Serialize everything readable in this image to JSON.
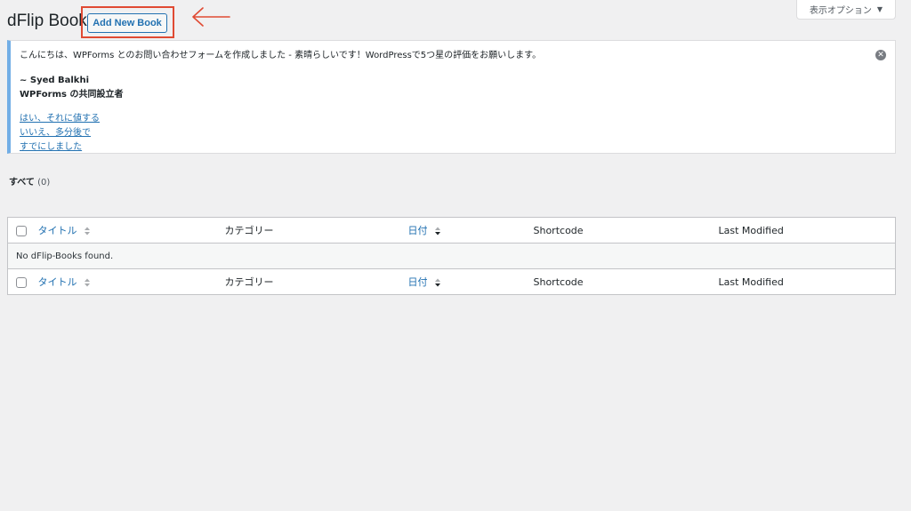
{
  "header": {
    "title": "dFlip Book",
    "add_new_label": "Add New Book",
    "screen_options_label": "表示オプション"
  },
  "notice": {
    "message": "こんにちは、WPForms とのお問い合わせフォームを作成しました - 素晴らしいです！WordPressで5つ星の評価をお願いします。",
    "signature_name": "~ Syed Balkhi",
    "signature_role": "WPForms の共同設立者",
    "links": [
      "はい、それに値する",
      "いいえ、多分後で",
      "すでにしました"
    ]
  },
  "filters": {
    "all_label": "すべて",
    "all_count": "(0)"
  },
  "table": {
    "columns": {
      "title": "タイトル",
      "category": "カテゴリー",
      "date": "日付",
      "shortcode": "Shortcode",
      "last_modified": "Last Modified"
    },
    "empty_message": "No dFlip-Books found."
  },
  "colors": {
    "accent": "#2271b1",
    "annotation": "#e04a33",
    "notice_border": "#72aee6"
  }
}
